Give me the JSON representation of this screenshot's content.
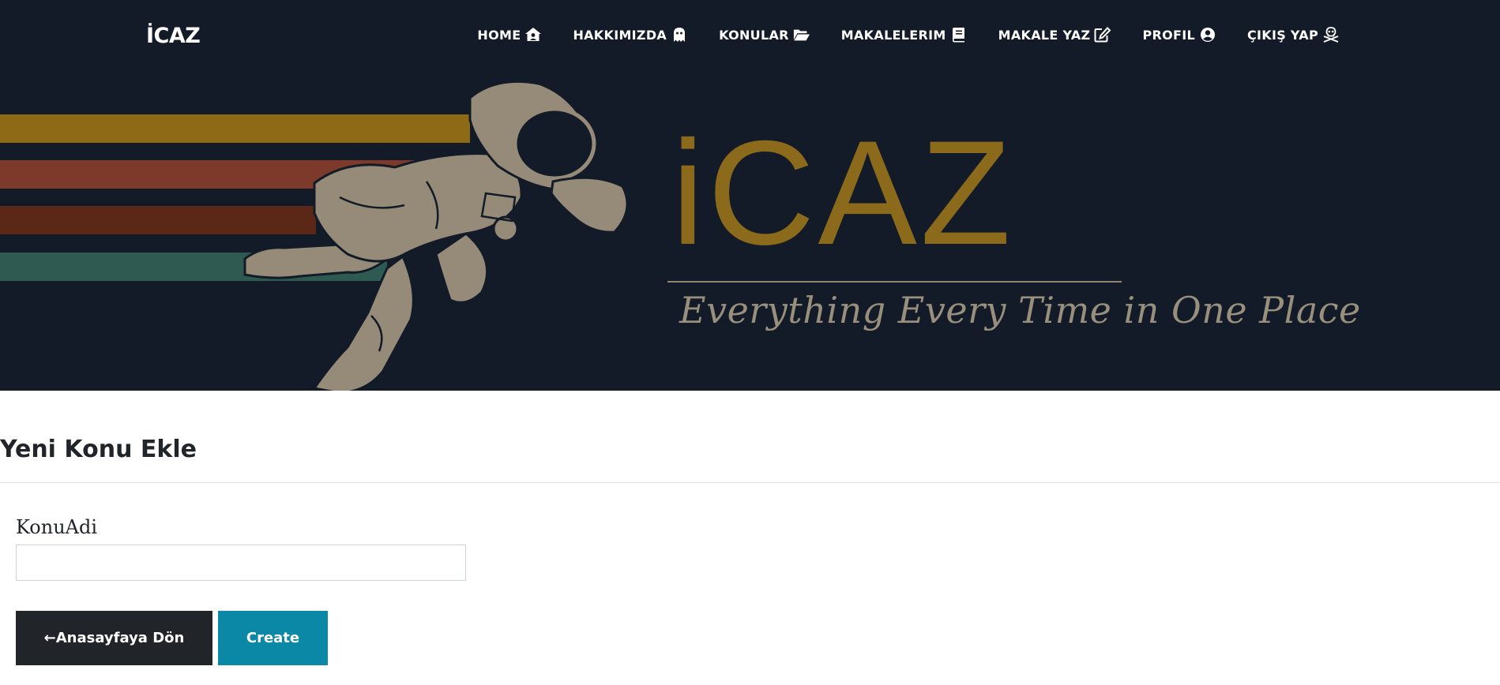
{
  "navbar": {
    "brand": "İCAZ",
    "items": [
      {
        "label": "HOME",
        "icon": "house-user-icon"
      },
      {
        "label": "HAKKIMIZDA",
        "icon": "ghost-icon"
      },
      {
        "label": "KONULAR",
        "icon": "folder-open-icon"
      },
      {
        "label": "MAKALELERIM",
        "icon": "book-icon"
      },
      {
        "label": "MAKALE YAZ",
        "icon": "edit-icon"
      },
      {
        "label": "PROFIL",
        "icon": "user-circle-icon"
      },
      {
        "label": "ÇIKIŞ YAP",
        "icon": "skull-crossbones-icon"
      }
    ]
  },
  "banner": {
    "logo_text": "iCAZ",
    "tagline": "Everything Every Time in One Place",
    "colors": {
      "background": "#121b27",
      "gold": "#8c6a1b",
      "stripe_gold": "#8e6a17",
      "stripe_red": "#7d3a2a",
      "stripe_brown": "#5b2818",
      "stripe_green": "#2f5a51",
      "astronaut": "#958b78"
    }
  },
  "main": {
    "title": "Yeni Konu Ekle",
    "form": {
      "label": "KonuAdi",
      "value": "",
      "placeholder": ""
    },
    "buttons": {
      "back": "←Anasayfaya Dön",
      "create": "Create"
    }
  },
  "colors": {
    "back_button": "#212529",
    "create_button": "#0a88a5"
  }
}
